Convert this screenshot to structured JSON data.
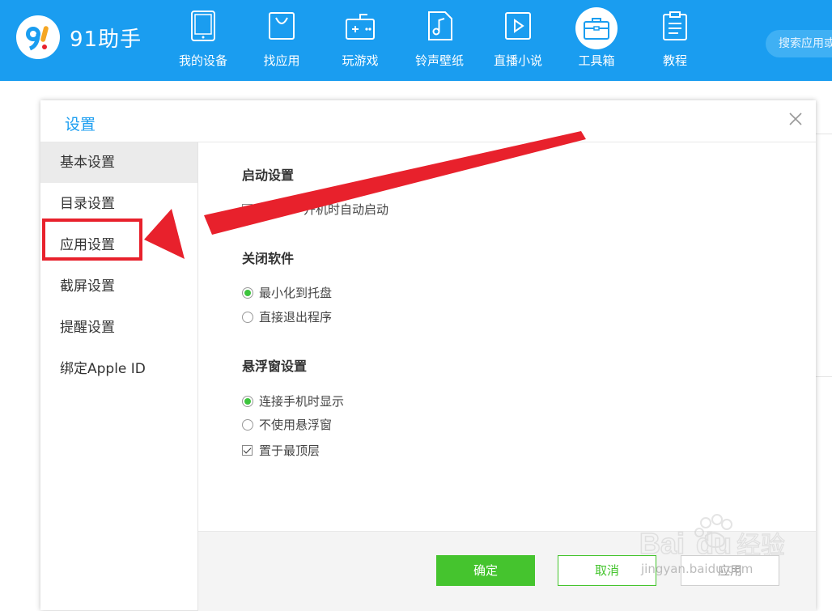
{
  "app": {
    "name": "91助手",
    "search_placeholder": "搜索应用或"
  },
  "nav": [
    {
      "label": "我的设备",
      "icon": "tablet-icon"
    },
    {
      "label": "找应用",
      "icon": "shopping-bag-icon"
    },
    {
      "label": "玩游戏",
      "icon": "gamepad-icon"
    },
    {
      "label": "铃声壁纸",
      "icon": "music-note-icon"
    },
    {
      "label": "直播小说",
      "icon": "play-icon"
    },
    {
      "label": "工具箱",
      "icon": "toolbox-icon",
      "active": true
    },
    {
      "label": "教程",
      "icon": "clipboard-icon"
    }
  ],
  "dialog": {
    "title": "设置",
    "sidebar": [
      {
        "label": "基本设置",
        "active": true
      },
      {
        "label": "目录设置"
      },
      {
        "label": "应用设置"
      },
      {
        "label": "截屏设置"
      },
      {
        "label": "提醒设置"
      },
      {
        "label": "绑定Apple ID"
      }
    ],
    "startup": {
      "title": "启动设置",
      "option_partial": "开机时自动启动",
      "checked": false
    },
    "close_software": {
      "title": "关闭软件",
      "options": [
        {
          "label": "最小化到托盘",
          "selected": true
        },
        {
          "label": "直接退出程序",
          "selected": false
        }
      ]
    },
    "floating_window": {
      "title": "悬浮窗设置",
      "options": [
        {
          "label": "连接手机时显示",
          "selected": true
        },
        {
          "label": "不使用悬浮窗",
          "selected": false
        }
      ],
      "checkbox": {
        "label": "置于最顶层",
        "checked": true
      }
    },
    "buttons": {
      "ok": "确定",
      "cancel": "取消",
      "apply": "应用"
    }
  },
  "watermark": {
    "brand": "Bai",
    "brand2": "du",
    "chinese": "经验",
    "url": "jingyan.baidu.com"
  },
  "colors": {
    "topbar": "#1a9df0",
    "accent_green": "#45c42e",
    "annotation_red": "#e8212c"
  }
}
